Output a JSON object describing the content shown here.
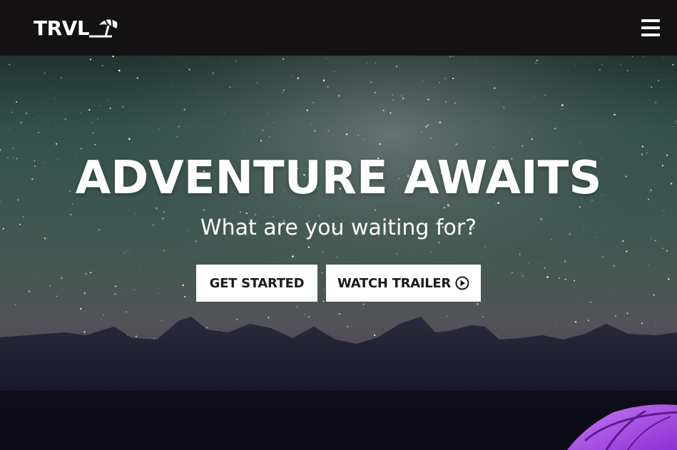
{
  "navbar": {
    "logo_text": "TRVL",
    "logo_icon": "beach-umbrella-icon",
    "menu_icon": "hamburger-menu-icon"
  },
  "hero": {
    "title": "ADVENTURE AWAITS",
    "subtitle": "What are you waiting for?",
    "buttons": {
      "get_started": "GET STARTED",
      "watch_trailer": "WATCH TRAILER",
      "watch_trailer_icon": "play-circle-icon"
    },
    "background": "starry-night-sky-mountains-tent"
  },
  "colors": {
    "navbar_bg": "#141212",
    "button_bg": "#ffffff",
    "button_text": "#1b1b1b",
    "tent": "#a94fe6"
  }
}
